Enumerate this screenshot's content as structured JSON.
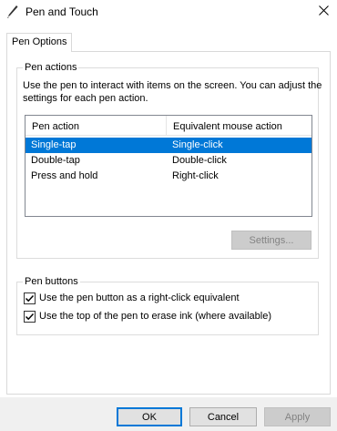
{
  "window": {
    "title": "Pen and Touch",
    "close_glyph": "✕"
  },
  "tabs": [
    {
      "label": "Pen Options"
    }
  ],
  "pen_actions": {
    "legend": "Pen actions",
    "description": "Use the pen to interact with items on the screen.  You can adjust the settings for each pen action.",
    "columns": [
      "Pen action",
      "Equivalent mouse action"
    ],
    "rows": [
      {
        "action": "Single-tap",
        "mouse": "Single-click",
        "selected": true
      },
      {
        "action": "Double-tap",
        "mouse": "Double-click",
        "selected": false
      },
      {
        "action": "Press and hold",
        "mouse": "Right-click",
        "selected": false
      }
    ],
    "settings_button": "Settings..."
  },
  "pen_buttons": {
    "legend": "Pen buttons",
    "options": [
      {
        "label": "Use the pen button as a right-click equivalent",
        "checked": true
      },
      {
        "label": "Use the top of the pen to erase ink (where available)",
        "checked": true
      }
    ]
  },
  "footer": {
    "ok": "OK",
    "cancel": "Cancel",
    "apply": "Apply"
  },
  "colors": {
    "selection": "#0078d7",
    "border": "#d9d9d9",
    "footer_bg": "#f0f0f0"
  }
}
